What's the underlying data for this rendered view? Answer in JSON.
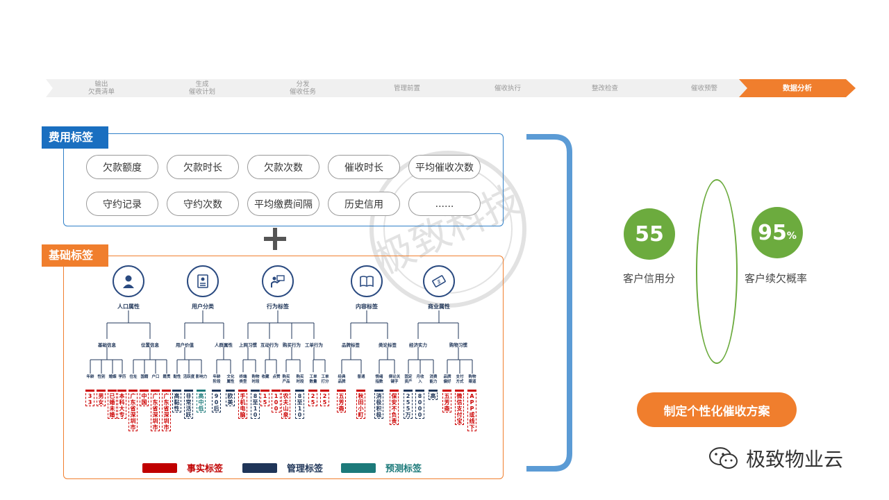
{
  "process": {
    "steps": [
      {
        "label": "输出\n欠费清单",
        "active": false
      },
      {
        "label": "生成\n催收计划",
        "active": false
      },
      {
        "label": "分发\n催收任务",
        "active": false
      },
      {
        "label": "管理前置",
        "active": false
      },
      {
        "label": "催收执行",
        "active": false
      },
      {
        "label": "整改检查",
        "active": false
      },
      {
        "label": "催收预警",
        "active": false
      },
      {
        "label": "数据分析",
        "active": true
      }
    ]
  },
  "fee_section": {
    "title": "费用标签",
    "pills": [
      "欠款额度",
      "欠款时长",
      "欠款次数",
      "催收时长",
      "平均催收次数",
      "守约记录",
      "守约次数",
      "平均缴费间隔",
      "历史信用",
      "......"
    ]
  },
  "base_section": {
    "title": "基础标签",
    "categories": [
      {
        "label": "人口属性",
        "icon": "person-icon"
      },
      {
        "label": "用户分类",
        "icon": "document-icon"
      },
      {
        "label": "行为标签",
        "icon": "presenter-icon"
      },
      {
        "label": "内容标签",
        "icon": "book-icon"
      },
      {
        "label": "商业属性",
        "icon": "money-icon"
      }
    ],
    "subcategories": [
      "基础信息",
      "位置信息",
      "用户价值",
      "人群属性",
      "上网习惯",
      "互动行为",
      "购买行为",
      "工单行为",
      "品牌标签",
      "类论标签",
      "经济实力",
      "购物习惯"
    ],
    "leaves": [
      "年龄",
      "性别",
      "婚姻",
      "学历",
      "住址",
      "国籍",
      "户口",
      "籍贯",
      "黏性",
      "活跃度",
      "影响力",
      "年龄\n阶段",
      "文化\n属性",
      "终端\n类型",
      "购物\n时段",
      "收藏",
      "点赞",
      "购买\n产品",
      "购买\n时段",
      "工单\n数量",
      "工单\n打分",
      "经典\n品牌",
      "普通",
      "情绪\n指数",
      "倒论关\n键字",
      "固定\n资产",
      "月收\n入",
      "消费\n能力",
      "品牌\n偏好",
      "支付\n方式",
      "购物\n渠道"
    ],
    "values": [
      "33",
      "男女",
      "已婚未婚",
      "本科大专",
      "广东省深圳市",
      "中国",
      "广东省深圳市",
      "广东省深圳市",
      "高黏性",
      "非常活跃",
      "高中低",
      "90后",
      "欧美",
      "手机电脑",
      "8至10",
      "15",
      "100",
      "农夫山泉",
      "8至10",
      "25",
      "25",
      "五芳斋",
      "秋田小町",
      "消极积极",
      "保安不负责",
      "255万",
      "8000",
      "高",
      "五芳斋",
      "微信支付宝",
      "APP或线下"
    ],
    "legend": [
      "事实标签",
      "管理标签",
      "预测标签"
    ]
  },
  "results": {
    "credit_score": "55",
    "credit_label": "客户信用分",
    "default_prob": "95",
    "default_unit": "%",
    "default_label": "客户续欠概率",
    "cta": "制定个性化催收方案"
  },
  "brand": {
    "name": "极致物业云",
    "stamp": "极致科技"
  },
  "colors": {
    "accent_orange": "#f07e2d",
    "accent_blue": "#1a6fc0",
    "green": "#6cab3e",
    "fact_red": "#c00000",
    "mgmt_navy": "#1f3558",
    "pred_teal": "#1c7a7a"
  }
}
